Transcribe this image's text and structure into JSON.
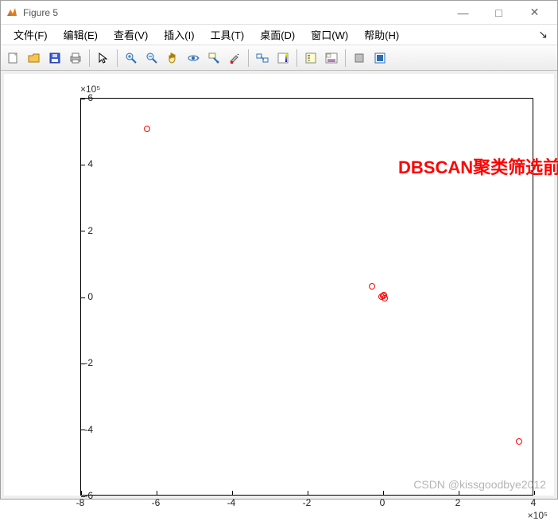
{
  "window": {
    "title": "Figure 5",
    "buttons": {
      "min": "—",
      "max": "□",
      "close": "✕"
    }
  },
  "menu": {
    "items": [
      "文件(F)",
      "编辑(E)",
      "查看(V)",
      "插入(I)",
      "工具(T)",
      "桌面(D)",
      "窗口(W)",
      "帮助(H)"
    ],
    "undock": "↘"
  },
  "toolbar": {
    "icons": [
      "new-figure",
      "open",
      "save",
      "print",
      "sep",
      "pointer",
      "sep",
      "zoom-in",
      "zoom-out",
      "pan",
      "rotate3d",
      "datacursor",
      "brush",
      "sep",
      "link",
      "colorbar",
      "sep",
      "insert-legend",
      "legend",
      "sep",
      "hide-plot",
      "show-plot"
    ]
  },
  "chart_data": {
    "type": "scatter",
    "title": "",
    "annotation": "DBSCAN聚类筛选前",
    "annotation_xy": [
      0.4,
      4.05
    ],
    "xlabel": "",
    "ylabel": "",
    "xlim": [
      -8,
      4
    ],
    "ylim": [
      -6,
      6
    ],
    "x_exp_label": "×10⁵",
    "y_exp_label": "×10⁵",
    "x_ticks": [
      -8,
      -6,
      -4,
      -2,
      0,
      2,
      4
    ],
    "y_ticks": [
      -6,
      -4,
      -2,
      0,
      2,
      4,
      6
    ],
    "series": [
      {
        "name": "points",
        "color": "#ff0000",
        "marker": "o",
        "points": [
          {
            "x": -6.25,
            "y": 5.08
          },
          {
            "x": -0.3,
            "y": 0.34
          },
          {
            "x": 0.0,
            "y": 0.04
          },
          {
            "x": -0.05,
            "y": 0.02
          },
          {
            "x": 0.05,
            "y": -0.02
          },
          {
            "x": 0.03,
            "y": 0.08
          },
          {
            "x": 3.6,
            "y": -4.35
          }
        ]
      }
    ]
  },
  "watermark": "CSDN @kissgoodbye2012"
}
